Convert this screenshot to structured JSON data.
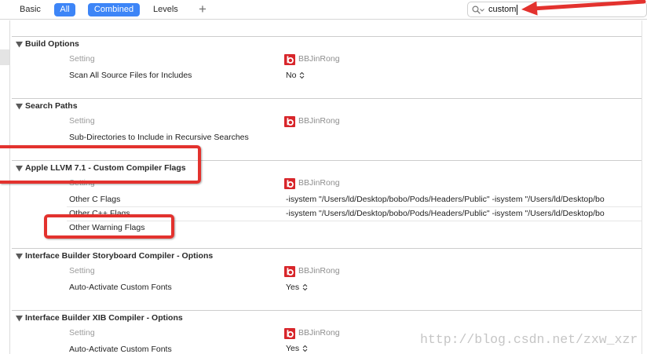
{
  "toolbar": {
    "basic_label": "Basic",
    "all_label": "All",
    "combined_label": "Combined",
    "levels_label": "Levels",
    "add_label": "+",
    "search_value": "custom",
    "all_selected": true,
    "combined_selected": true
  },
  "sections": [
    {
      "title": "Build Options",
      "setting_label": "Setting",
      "target": "BBJinRong",
      "rows": [
        {
          "name": "Scan All Source Files for Includes",
          "value": "No"
        }
      ]
    },
    {
      "title": "Search Paths",
      "setting_label": "Setting",
      "target": "BBJinRong",
      "rows": [
        {
          "name": "Sub-Directories to Include in Recursive Searches"
        }
      ]
    },
    {
      "title": "Apple LLVM 7.1 - Custom Compiler Flags",
      "setting_label": "Setting",
      "target": "BBJinRong",
      "rows": [
        {
          "name": "Other C Flags",
          "value": "-isystem \"/Users/ld/Desktop/bobo/Pods/Headers/Public\" -isystem \"/Users/ld/Desktop/bo"
        },
        {
          "name": "Other C++ Flags",
          "value": "-isystem \"/Users/ld/Desktop/bobo/Pods/Headers/Public\" -isystem \"/Users/ld/Desktop/bo"
        },
        {
          "name": "Other Warning Flags"
        }
      ]
    },
    {
      "title": "Interface Builder Storyboard Compiler - Options",
      "setting_label": "Setting",
      "target": "BBJinRong",
      "rows": [
        {
          "name": "Auto-Activate Custom Fonts",
          "value": "Yes"
        }
      ]
    },
    {
      "title": "Interface Builder XIB Compiler - Options",
      "setting_label": "Setting",
      "target": "BBJinRong",
      "rows": [
        {
          "name": "Auto-Activate Custom Fonts",
          "value": "Yes"
        }
      ]
    }
  ],
  "watermark": "http://blog.csdn.net/zxw_xzr",
  "icons": {
    "search": "magnifier-icon",
    "section_toggle": "disclosure-triangle-icon",
    "target": "target-app-icon",
    "value_popup": "stepper-chevron-icon"
  },
  "colors": {
    "selected_button": "#3d85f7",
    "annotation": "#e3322e",
    "target_icon": "#d8262b"
  }
}
